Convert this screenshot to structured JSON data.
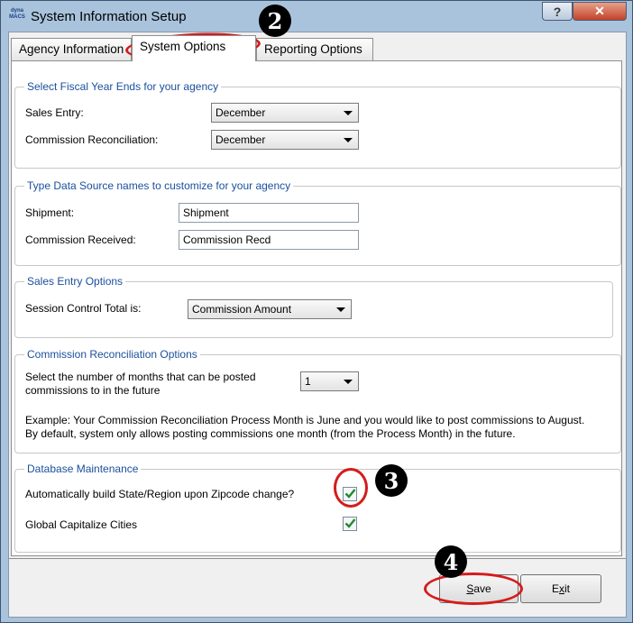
{
  "window": {
    "logo_text": "dyna MACS",
    "title": "System Information Setup",
    "help_label": "?",
    "close_label": "✕"
  },
  "tabs": [
    {
      "label": "Agency Information"
    },
    {
      "label": "System Options"
    },
    {
      "label": "Reporting Options"
    }
  ],
  "fiscal": {
    "legend": "Select Fiscal Year Ends for your agency",
    "sales_label": "Sales Entry:",
    "sales_value": "December",
    "commission_label": "Commission Reconciliation:",
    "commission_value": "December"
  },
  "datasource": {
    "legend": "Type Data Source names to customize for your agency",
    "shipment_label": "Shipment:",
    "shipment_value": "Shipment",
    "received_label": "Commission Received:",
    "received_value": "Commission Recd"
  },
  "sales_entry": {
    "legend": "Sales Entry Options",
    "session_label": "Session Control Total is:",
    "session_value": "Commission Amount"
  },
  "comm_recon": {
    "legend": "Commission Reconciliation Options",
    "months_label_1": "Select the number of months that can be posted",
    "months_label_2": "commissions to in the future",
    "months_value": "1",
    "example_1": "Example: Your Commission Reconciliation Process Month is June and you would like to post commissions to August.",
    "example_2": "By default, system only allows posting commissions one month (from the Process Month) in the future."
  },
  "db_maint": {
    "legend": "Database Maintenance",
    "auto_build_label": "Automatically build State/Region upon Zipcode change?",
    "auto_build_checked": true,
    "capitalize_label": "Global Capitalize Cities",
    "capitalize_checked": true
  },
  "buttons": {
    "save_prefix": "",
    "save_key": "S",
    "save_rest": "ave",
    "exit_prefix": "E",
    "exit_key": "x",
    "exit_rest": "it"
  },
  "annotations": {
    "marker_tab": "2",
    "marker_checkbox": "3",
    "marker_save": "4",
    "ring_color": "#d41c1c"
  }
}
